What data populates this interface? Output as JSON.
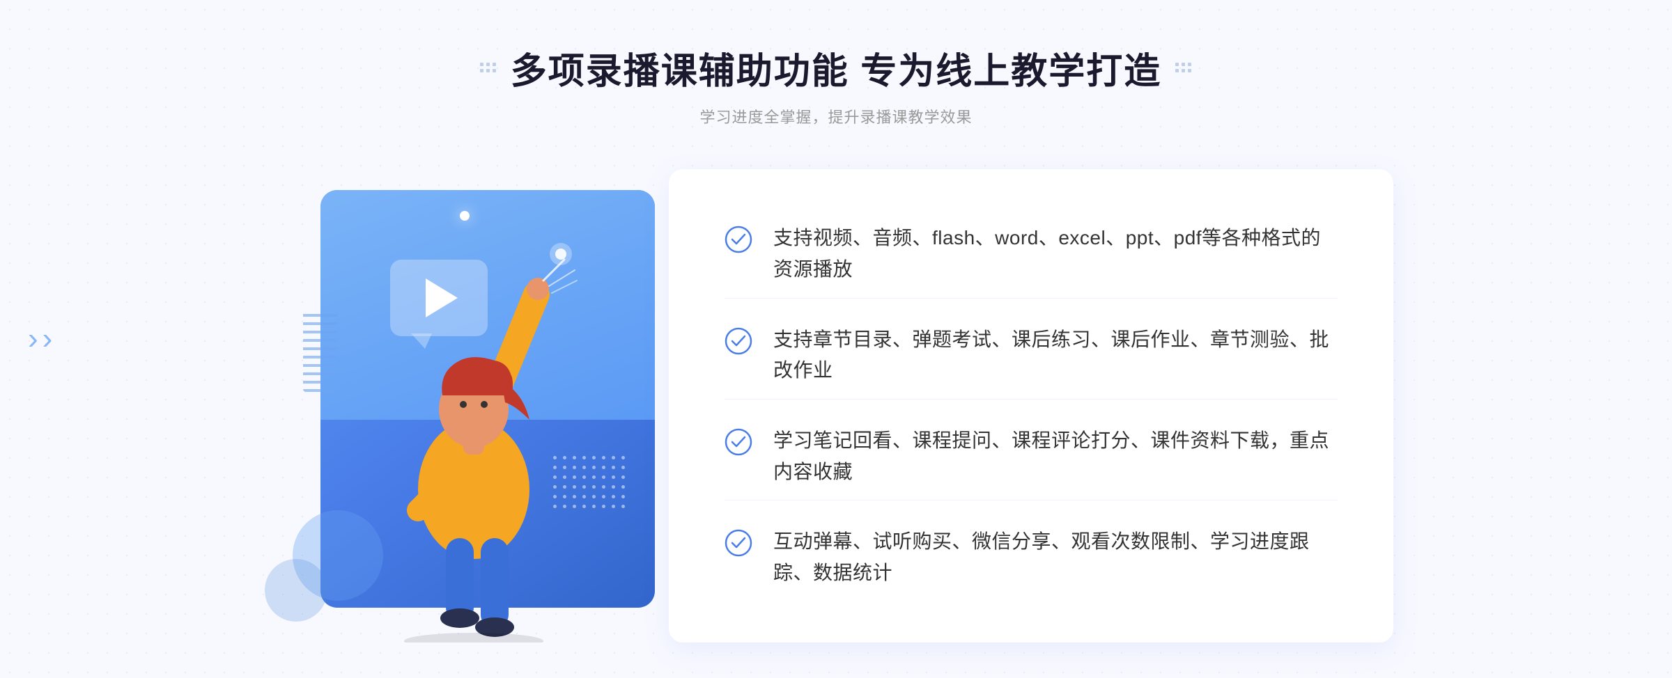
{
  "header": {
    "title": "多项录播课辅助功能 专为线上教学打造",
    "subtitle": "学习进度全掌握，提升录播课教学效果",
    "decoration_dots": 6
  },
  "features": [
    {
      "id": 1,
      "text": "支持视频、音频、flash、word、excel、ppt、pdf等各种格式的资源播放"
    },
    {
      "id": 2,
      "text": "支持章节目录、弹题考试、课后练习、课后作业、章节测验、批改作业"
    },
    {
      "id": 3,
      "text": "学习笔记回看、课程提问、课程评论打分、课件资料下载，重点内容收藏"
    },
    {
      "id": 4,
      "text": "互动弹幕、试听购买、微信分享、观看次数限制、学习进度跟踪、数据统计"
    }
  ],
  "illustration": {
    "play_bubble": true
  },
  "colors": {
    "primary_blue": "#4a7de8",
    "light_blue": "#7ab3f7",
    "check_color": "#4a7de8",
    "text_dark": "#333333",
    "text_gray": "#999999",
    "bg_light": "#f8f9ff"
  }
}
